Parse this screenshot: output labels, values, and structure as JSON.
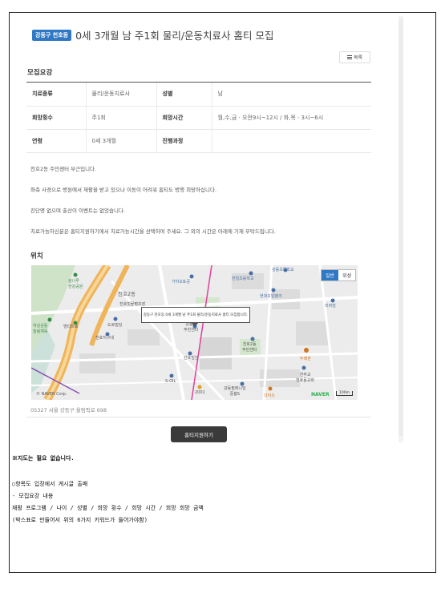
{
  "header": {
    "badge": "강동구 천호동",
    "title": "0세 3개월 남 주1회 물리/운동치료사 홈티 모집",
    "list_button": "목록"
  },
  "section": {
    "title": "모집요강"
  },
  "info_table": {
    "rows": [
      {
        "k1": "치료종류",
        "v1": "물리/운동치료사",
        "k2": "성별",
        "v2": "남"
      },
      {
        "k1": "희망횟수",
        "v1": "주1회",
        "k2": "희망시간",
        "v2": "월,수,금 · 오전9시~12시 / 화,목 · 3시~6시"
      },
      {
        "k1": "연령",
        "v1": "0세 3개월",
        "k2": "진행과정",
        "v2": ""
      }
    ]
  },
  "description": [
    "천호2동 주민센터 부근입니다.",
    "좌측 사경으로 병원에서 재활을 받고 있으나 이동이 어려워 홈티도 병행 희망하십니다.",
    "진단명 없으며 출산이 이벤트는 없었습니다.",
    "치료가능하신분은 홈티지원하기에서 치료가능시간을 선택하여 주세요. 그 외의 시간은 아래에 기재 부탁드립니다."
  ],
  "location": {
    "title": "위치",
    "map": {
      "toggle_normal": "일반",
      "toggle_satellite": "위성",
      "popup": "강동구 천호동 0세 3개월 남 주1회 물리/운동치료사 홈티 모집합니다.",
      "labels": {
        "park": "광나루\n한강공원",
        "cheonho2": "천호2동",
        "cheonho_market": "천호빗물펌프장",
        "gaya": "가야오토공",
        "hanil": "한일초등학교",
        "gangdong_elem": "강동초등학교",
        "hyundai": "현대오일뱅크",
        "rivermall": "리버빌",
        "sewer": "하성운동\n놀림체육",
        "seongnae": "명티트로",
        "dodol": "도로빌딩",
        "center": "강동구\n주민센터",
        "cheonho2_center": "천호2동\n주민센터",
        "dure": "두레촌",
        "sanho": "산호빌딩",
        "sOil": "S-OIL",
        "crossing": "천호지구대",
        "bldg2001": "2001",
        "gangdong_museum": "강동필레니엄\n중흥S",
        "daiso": "다이소",
        "church": "천주교\n천호동교회",
        "ho": "한풍",
        "east": "동"
      },
      "copyright": "© NAVER Corp.",
      "logo": "NAVER",
      "scale": "100m"
    },
    "address": "05327 서울 강동구 올림픽로 698"
  },
  "apply_button": "홈티지원하기",
  "notes": [
    "※지도는 필요 없습니다.",
    "",
    "○항목도 입장에서 게시글 출패",
    "- 모집요강 내용",
    "재활 프로그램 / 나이 / 성별 / 희망 횟수 / 희망 시간 / 희망 희망 금액",
    "(박스표로 만들어서 위의 6가지 키워드가 들어가야함)"
  ],
  "colors": {
    "badge": "#2f78c4",
    "apply_button": "#3a3a3a",
    "map_road_orange": "#f0b45a",
    "map_road_pink": "#e0409a"
  }
}
